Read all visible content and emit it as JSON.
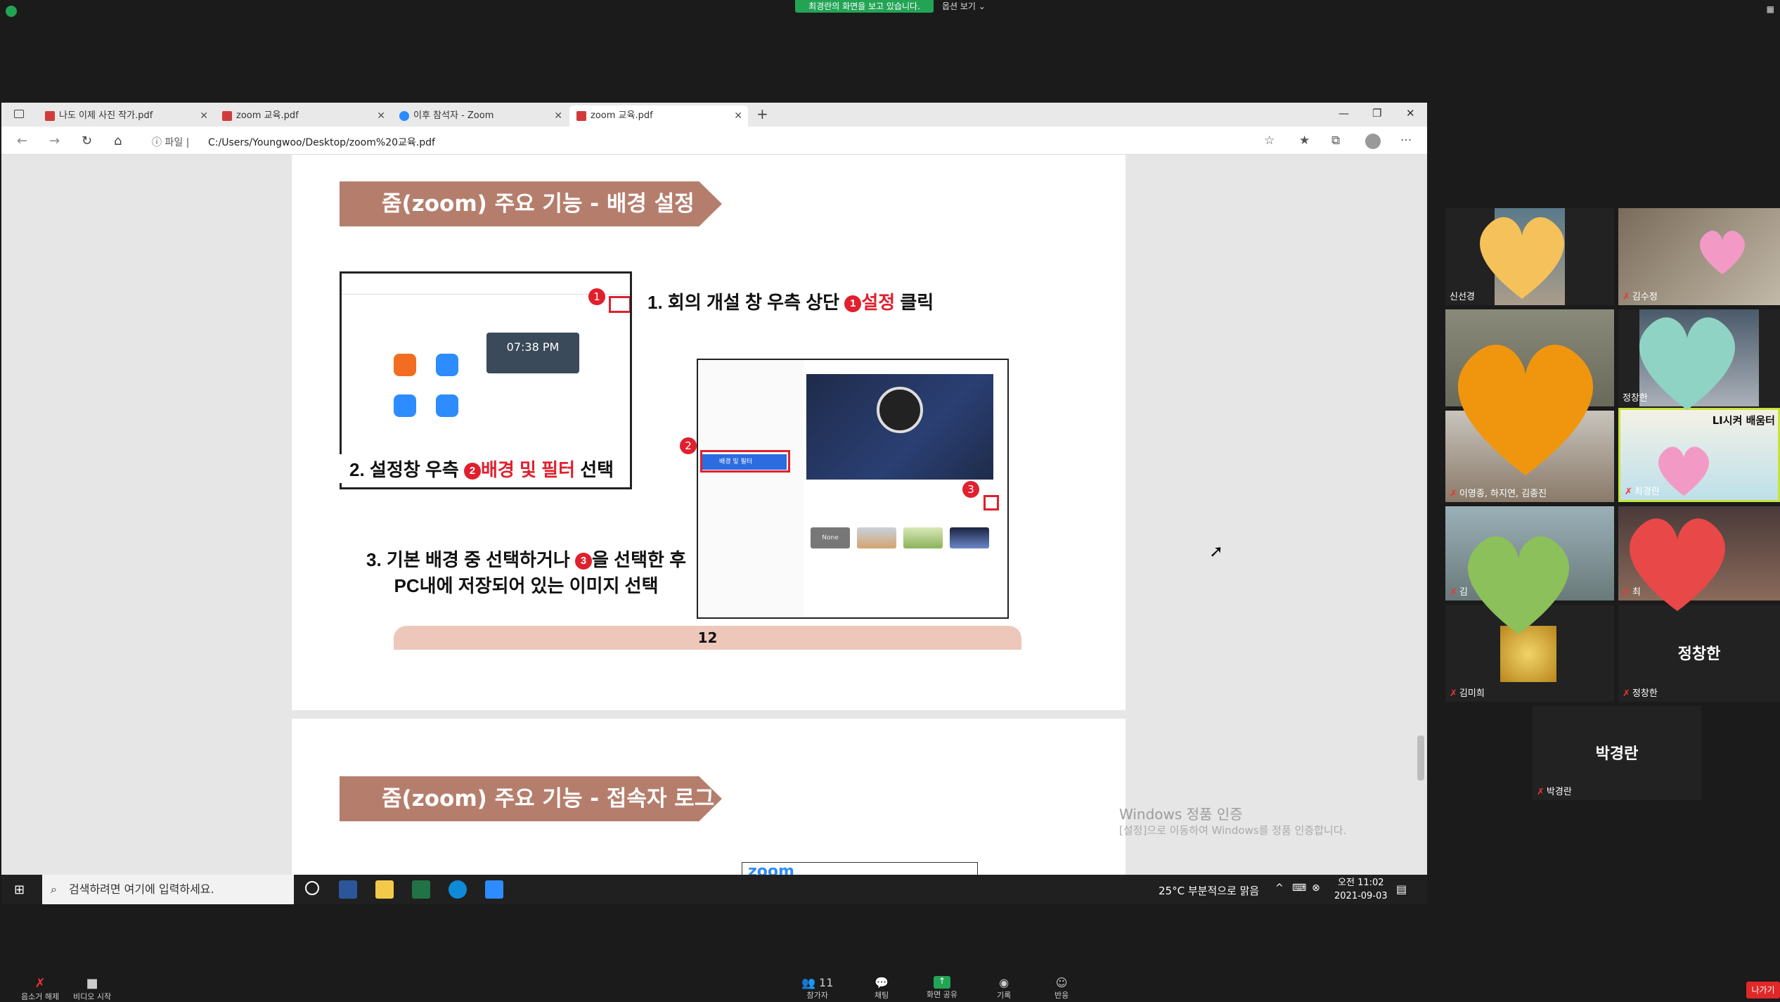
{
  "zoom": {
    "share_banner": "최경란의 화면을 보고 있습니다.",
    "view_options": "옵션 보기 ⌄",
    "toolbar": {
      "mute": "음소거 해제",
      "video": "비디오 시작",
      "participants": "참가자",
      "participants_count": "11",
      "chat": "채팅",
      "share": "화면 공유",
      "record": "기록",
      "reactions": "반응",
      "leave": "나가기"
    },
    "participants": [
      {
        "name": "신선경"
      },
      {
        "name": "김수정"
      },
      {
        "name": ""
      },
      {
        "name": "정창한"
      },
      {
        "name": "이영종, 하지연, 김종진"
      },
      {
        "name": "최경란"
      },
      {
        "name": "김"
      },
      {
        "name": "최"
      },
      {
        "name": "김미희"
      },
      {
        "name": "정창한",
        "big": "정창한"
      },
      {
        "name": "박경란",
        "big": "박경란"
      }
    ],
    "tile_overlay_text": "LI시켜 배움터"
  },
  "browser": {
    "tabs": [
      {
        "label": "나도 이제 사진 작가.pdf",
        "icon": "pdf-icon"
      },
      {
        "label": "zoom 교육.pdf",
        "icon": "pdf-icon"
      },
      {
        "label": "이후 참석자 - Zoom",
        "icon": "zoom-icon"
      },
      {
        "label": "zoom 교육.pdf",
        "icon": "pdf-icon",
        "active": true
      }
    ],
    "address_label": "파일",
    "address_url": "C:/Users/Youngwoo/Desktop/zoom%20교육.pdf"
  },
  "pdf": {
    "page1": {
      "banner": "줌(zoom) 주요 기능 - 배경 설정",
      "step1_a": "1. 회의 개설 창 우측 상단 ",
      "step1_num": "1",
      "step1_red": "설정",
      "step1_b": " 클릭",
      "step2_a": "2. 설정창 우측 ",
      "step2_num": "2",
      "step2_red": "배경 및 필터",
      "step2_b": " 선택",
      "step3_a": "3. 기본 배경 중 선택하거나 ",
      "step3_num": "3",
      "step3_b": "을 선택한 후",
      "step3_c": "PC내에 저장되어 있는 이미지 선택",
      "clock": "07:38 PM",
      "page_number": "12",
      "badge1": "1",
      "badge2": "2",
      "badge3": "3",
      "settings_selected": "배경 및 필터",
      "bg_none": "None"
    },
    "page2": {
      "banner": "줌(zoom) 주요 기능 - 접속자 로그기록",
      "zoom_logo": "zoom"
    }
  },
  "taskbar": {
    "search_placeholder": "검색하려면 여기에 입력하세요.",
    "weather": "25°C 부분적으로 맑음",
    "time": "오전 11:02",
    "date": "2021-09-03"
  },
  "watermark": {
    "line1": "Windows 정품 인증",
    "line2": "[설정]으로 이동하여 Windows를 정품 인증합니다."
  }
}
